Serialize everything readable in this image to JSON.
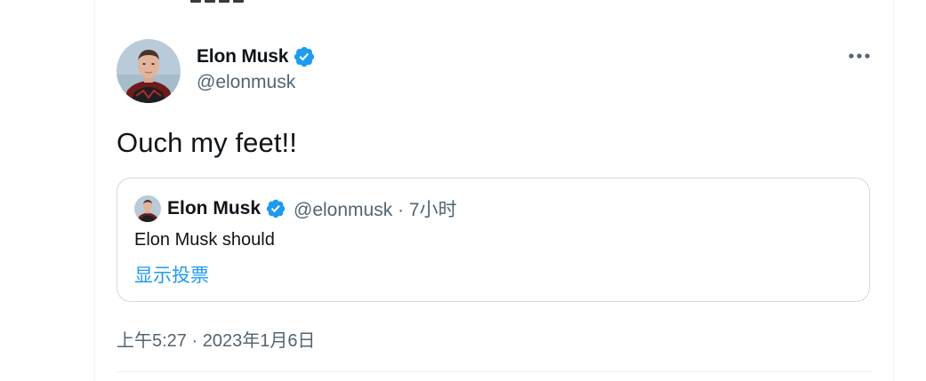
{
  "tweet": {
    "author_name": "Elon Musk",
    "author_handle": "@elonmusk",
    "text": "Ouch my feet!!",
    "timestamp": "上午5:27 · 2023年1月6日",
    "verified_color": "#1d9bf0"
  },
  "quoted_tweet": {
    "author_name": "Elon Musk",
    "meta": "@elonmusk · 7小时",
    "text": "Elon Musk should",
    "show_poll_link": "显示投票"
  },
  "icons": {
    "verified": "verified-badge-icon",
    "more": "more-options-icon"
  }
}
